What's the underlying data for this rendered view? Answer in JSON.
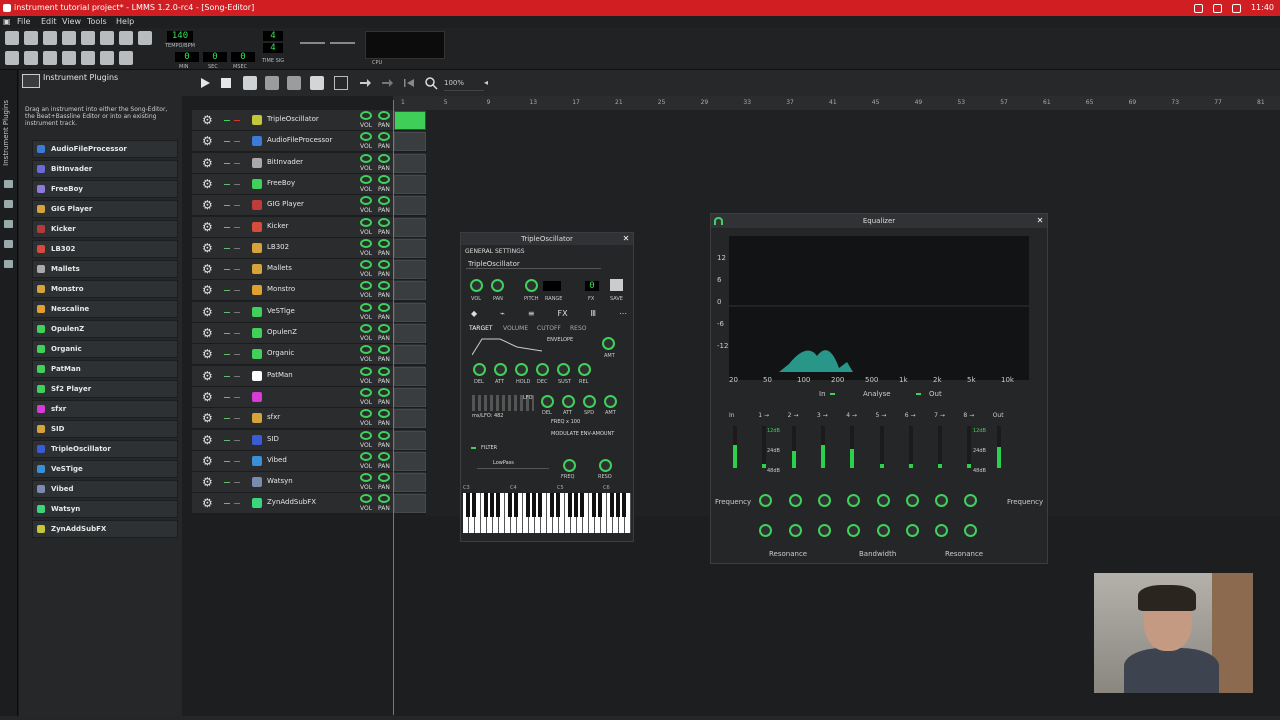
{
  "window": {
    "title": "instrument tutorial project* - LMMS 1.2.0-rc4 - [Song-Editor]",
    "clock": "11:40"
  },
  "menu": [
    "File",
    "Edit",
    "View",
    "Tools",
    "Help"
  ],
  "toolbar": {
    "tempo_label": "TEMPO/BPM",
    "tempo": "140",
    "time_min": "0",
    "time_sec": "0",
    "time_msec": "0",
    "min_label": "MIN",
    "sec_label": "SEC",
    "msec_label": "MSEC",
    "timesig_top": "4",
    "timesig_bottom": "4",
    "timesig_label": "TIME SIG",
    "cpu_label": "CPU"
  },
  "sidebar": {
    "tab_label": "Instrument Plugins"
  },
  "plugins_panel": {
    "header": "Instrument Plugins",
    "hint": "Drag an instrument into either the Song-Editor, the Beat+Bassline Editor or into an existing instrument track.",
    "items": [
      "AudioFileProcessor",
      "BitInvader",
      "FreeBoy",
      "GIG Player",
      "Kicker",
      "LB302",
      "Mallets",
      "Monstro",
      "Nescaline",
      "OpulenZ",
      "Organic",
      "PatMan",
      "Sf2 Player",
      "sfxr",
      "SID",
      "TripleOscillator",
      "VeSTige",
      "Vibed",
      "Watsyn",
      "ZynAddSubFX"
    ]
  },
  "song_editor": {
    "zoom": "100%",
    "ticks": [
      "1",
      "5",
      "9",
      "13",
      "17",
      "21",
      "25",
      "29",
      "33",
      "37",
      "41",
      "45",
      "49",
      "53",
      "57",
      "61",
      "65",
      "69",
      "73",
      "77",
      "81"
    ]
  },
  "tracks": {
    "vol": "VOL",
    "pan": "PAN",
    "items": [
      "TripleOscillator",
      "AudioFileProcessor",
      "BitInvader",
      "FreeBoy",
      "GIG Player",
      "Kicker",
      "LB302",
      "Mallets",
      "Monstro",
      "VeSTige",
      "OpulenZ",
      "Organic",
      "PatMan",
      "",
      "sfxr",
      "SID",
      "Vibed",
      "Watsyn",
      "ZynAddSubFX"
    ]
  },
  "tripleosc": {
    "title": "TripleOscillator",
    "general": "GENERAL SETTINGS",
    "name": "TripleOscillator",
    "vol": "VOL",
    "pan": "PAN",
    "pitch": "PITCH",
    "range": "RANGE",
    "fx": "FX",
    "save": "SAVE",
    "channel": "0",
    "tab_target": "TARGET",
    "tab_volume": "VOLUME",
    "tab_cutoff": "CUTOFF",
    "tab_reso": "RESO",
    "envelope": "ENVELOPE",
    "amt": "AMT",
    "env_knobs": [
      "DEL",
      "ATT",
      "HOLD",
      "DEC",
      "SUST",
      "REL"
    ],
    "lfo": "LFO",
    "lfo_knobs": [
      "DEL",
      "ATT",
      "SPD",
      "AMT"
    ],
    "lfo_info": "ms/LFO: 482",
    "freq_x": "FREQ x 100",
    "modulate": "MODULATE ENV-AMOUNT",
    "filter": "FILTER",
    "filter_type": "LowPass",
    "freq": "FREQ",
    "reso": "RESO",
    "key_labels": [
      "C3",
      "C4",
      "C5",
      "C6"
    ]
  },
  "equalizer": {
    "title": "Equalizer",
    "db_ticks": [
      "12",
      "6",
      "0",
      "-6",
      "-12"
    ],
    "freq_ticks": [
      "20",
      "50",
      "100",
      "200",
      "500",
      "1k",
      "2k",
      "5k",
      "10k"
    ],
    "in": "In",
    "analyse": "Analyse",
    "out": "Out",
    "bands": [
      "In",
      "1 →",
      "2 →",
      "3 →",
      "4 →",
      "5 →",
      "6 →",
      "7 →",
      "8 →",
      "Out"
    ],
    "db12": "12dB",
    "db24": "24dB",
    "db48": "48dB",
    "frequency": "Frequency",
    "resonance": "Resonance",
    "bandwidth": "Bandwidth"
  }
}
